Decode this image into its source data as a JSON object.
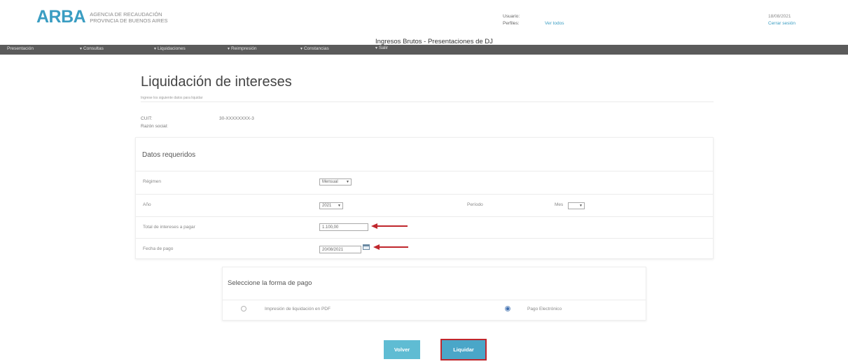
{
  "header": {
    "logo_text": "ARBA",
    "logo_sub_line1": "AGENCIA DE RECAUDACIÓN",
    "logo_sub_line2": "PROVINCIA DE BUENOS AIRES",
    "usuario_label": "Usuario:",
    "perfiles_label": "Perfiles:",
    "perfiles_link": "Ver todos",
    "date": "18/08/2021",
    "logout_link": "Cerrar sesión",
    "brand_color": "#3a9dc2"
  },
  "module_title": "Ingresos Brutos - Presentaciones de DJ",
  "nav": {
    "items": [
      "Presentación",
      "Consultas",
      "Liquidaciones",
      "Reimpresión",
      "Constancias",
      "Salir"
    ]
  },
  "page": {
    "title": "Liquidación de intereses",
    "subtitle": "Ingrese los siguiente datos para liquidar",
    "cuit_label": "CUIT:",
    "cuit_value": "30-XXXXXXXX-3",
    "razon_label": "Razón social:"
  },
  "datos": {
    "title": "Datos requeridos",
    "regimen_label": "Régimen",
    "regimen_value": "Mensual",
    "anio_label": "Año",
    "anio_value": "2021",
    "periodo_label": "Período",
    "mes_label": "Mes",
    "mes_value": "",
    "total_label": "Total de intereses a pagar",
    "total_value": "1.100,00",
    "fecha_label": "Fecha de pago",
    "fecha_value": "20/08/2021"
  },
  "pago": {
    "title": "Seleccione la forma de pago",
    "option_pdf": "Impresión de liquidación en PDF",
    "option_electronico": "Pago Electrónico",
    "selected": "Pago Electrónico"
  },
  "buttons": {
    "volver": "Volver",
    "liquidar": "Liquidar"
  },
  "annotation_color": "#c0272d"
}
